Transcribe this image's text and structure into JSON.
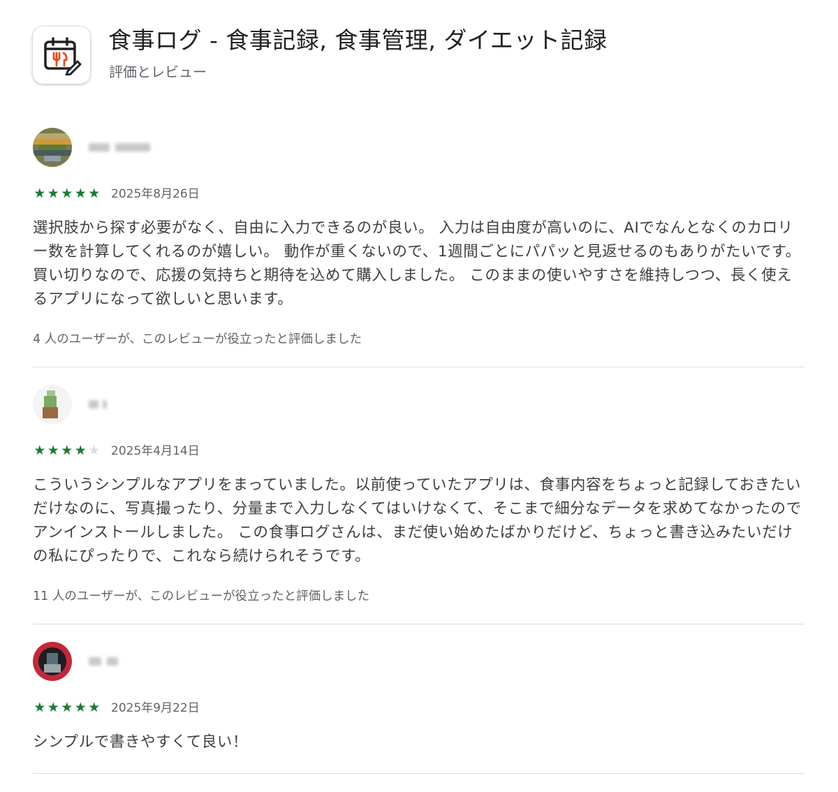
{
  "app": {
    "title": "食事ログ - 食事記録, 食事管理, ダイエット記録",
    "subtitle": "評価とレビュー",
    "icon": "calendar-fork-pencil-icon",
    "accent_color": "#e8491d"
  },
  "star_color": "#1b7a33",
  "reviews": [
    {
      "username": "",
      "rating": 5,
      "max_rating": 5,
      "date": "2025年8月26日",
      "text": "選択肢から探す必要がなく、自由に入力できるのが良い。 入力は自由度が高いのに、AIでなんとなくのカロリー数を計算してくれるのが嬉しい。 動作が重くないので、1週間ごとにパパッと見返せるのもありがたいです。 買い切りなので、応援の気持ちと期待を込めて購入しました。 このままの使いやすさを維持しつつ、長く使えるアプリになって欲しいと思います。",
      "helpful": "4 人のユーザーが、このレビューが役立ったと評価しました"
    },
    {
      "username": "",
      "rating": 4,
      "max_rating": 5,
      "date": "2025年4月14日",
      "text": "こういうシンプルなアプリをまっていました。以前使っていたアプリは、食事内容をちょっと記録しておきたいだけなのに、写真撮ったり、分量まで入力しなくてはいけなくて、そこまで細分なデータを求めてなかったのでアンインストールしました。 この食事ログさんは、まだ使い始めたばかりだけど、ちょっと書き込みたいだけの私にぴったりで、これなら続けられそうです。",
      "helpful": "11 人のユーザーが、このレビューが役立ったと評価しました"
    },
    {
      "username": "",
      "rating": 5,
      "max_rating": 5,
      "date": "2025年9月22日",
      "text": "シンプルで書きやすくて良い！",
      "helpful": ""
    }
  ]
}
